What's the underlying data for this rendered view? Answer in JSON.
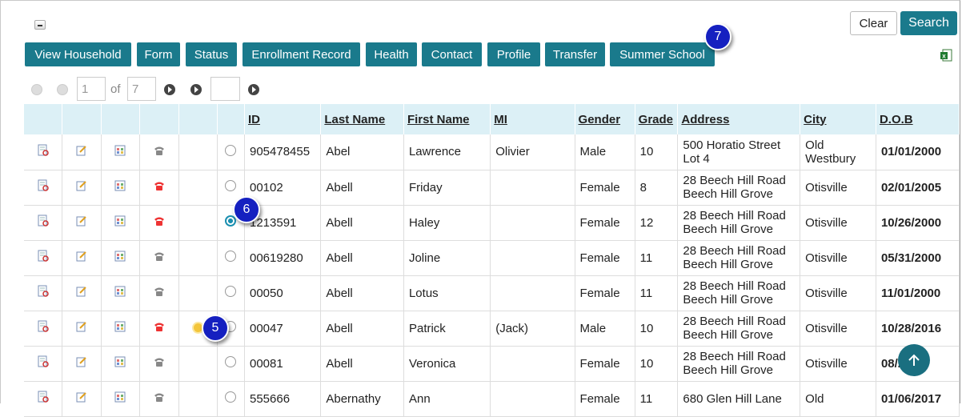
{
  "header": {
    "clear_label": "Clear",
    "search_label": "Search"
  },
  "toolbar": {
    "buttons": [
      "View Household",
      "Form",
      "Status",
      "Enrollment Record",
      "Health",
      "Contact",
      "Profile",
      "Transfer",
      "Summer School"
    ]
  },
  "pager": {
    "current_page": "1",
    "of_label": "of",
    "total_pages": "7",
    "goto_value": ""
  },
  "table": {
    "columns": [
      "ID",
      "Last Name",
      "First Name",
      "MI",
      "Gender",
      "Grade",
      "Address",
      "City",
      "D.O.B"
    ],
    "rows": [
      {
        "phone": "gray",
        "selected": false,
        "flag": false,
        "id": "905478455",
        "last": "Abel",
        "first": "Lawrence",
        "mi": "Olivier",
        "gender": "Male",
        "grade": "10",
        "addr1": "500 Horatio Street",
        "addr2": "Lot 4",
        "city1": "Old",
        "city2": "Westbury",
        "dob": "01/01/2000"
      },
      {
        "phone": "red",
        "selected": false,
        "flag": false,
        "id": "00102",
        "last": "Abell",
        "first": "Friday",
        "mi": "",
        "gender": "Female",
        "grade": "8",
        "addr1": "28 Beech Hill Road",
        "addr2": "Beech Hill Grove",
        "city1": "Otisville",
        "city2": "",
        "dob": "02/01/2005"
      },
      {
        "phone": "red",
        "selected": true,
        "flag": false,
        "id": "1213591",
        "last": "Abell",
        "first": "Haley",
        "mi": "",
        "gender": "Female",
        "grade": "12",
        "addr1": "28 Beech Hill Road",
        "addr2": "Beech Hill Grove",
        "city1": "Otisville",
        "city2": "",
        "dob": "10/26/2000"
      },
      {
        "phone": "gray",
        "selected": false,
        "flag": false,
        "id": "00619280",
        "last": "Abell",
        "first": "Joline",
        "mi": "",
        "gender": "Female",
        "grade": "11",
        "addr1": "28 Beech Hill Road",
        "addr2": "Beech Hill Grove",
        "city1": "Otisville",
        "city2": "",
        "dob": "05/31/2000"
      },
      {
        "phone": "gray",
        "selected": false,
        "flag": false,
        "id": "00050",
        "last": "Abell",
        "first": "Lotus",
        "mi": "",
        "gender": "Female",
        "grade": "11",
        "addr1": "28 Beech Hill Road",
        "addr2": "Beech Hill Grove",
        "city1": "Otisville",
        "city2": "",
        "dob": "11/01/2000"
      },
      {
        "phone": "red",
        "selected": false,
        "flag": true,
        "id": "00047",
        "last": "Abell",
        "first": "Patrick",
        "mi": "(Jack)",
        "gender": "Male",
        "grade": "10",
        "addr1": "28 Beech Hill Road",
        "addr2": "Beech Hill Grove",
        "city1": "Otisville",
        "city2": "",
        "dob": "10/28/2016"
      },
      {
        "phone": "gray",
        "selected": false,
        "flag": false,
        "id": "00081",
        "last": "Abell",
        "first": "Veronica",
        "mi": "",
        "gender": "Female",
        "grade": "10",
        "addr1": "28 Beech Hill Road",
        "addr2": "Beech Hill Grove",
        "city1": "Otisville",
        "city2": "",
        "dob": "08/2000"
      },
      {
        "phone": "gray",
        "selected": false,
        "flag": false,
        "id": "555666",
        "last": "Abernathy",
        "first": "Ann",
        "mi": "",
        "gender": "Female",
        "grade": "11",
        "addr1": "680 Glen Hill Lane",
        "addr2": "",
        "city1": "Old",
        "city2": "",
        "dob": "01/06/2017"
      }
    ]
  },
  "callouts": {
    "c5": "5",
    "c6": "6",
    "c7": "7"
  },
  "icons": [
    "collapse-icon",
    "view-record-icon",
    "edit-icon",
    "schedule-icon",
    "phone-icon",
    "excel-export-icon",
    "first-page-icon",
    "prev-page-icon",
    "next-page-icon",
    "last-page-icon",
    "go-icon",
    "scroll-top-icon",
    "alert-flag-icon"
  ],
  "colors": {
    "accent": "#1a7a8c",
    "header_bg": "#dcf0f6",
    "callout": "#1520c0"
  }
}
